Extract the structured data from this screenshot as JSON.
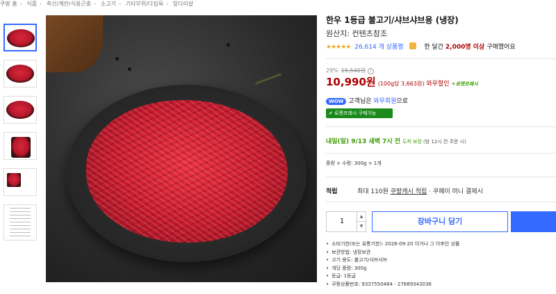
{
  "breadcrumb": [
    "쿠팡 홈",
    "식품",
    "축산/계란/식용곤충",
    "소고기",
    "기타부위/다짐육",
    "앞다리살"
  ],
  "breadcrumb_sep": "›",
  "product": {
    "title": "한우 1등급 불고기/샤브샤브용 (냉장)",
    "origin": "원산지: 컨텐츠참조",
    "stars": "★★★★★",
    "reviews": "26,614 개 상품평",
    "bought_prefix": "한 달간",
    "bought_count": "2,000명 이상",
    "bought_suffix": "구매했어요"
  },
  "price": {
    "discount_rate": "29%",
    "original": "15,540원",
    "info_icon": "i",
    "final": "10,990원",
    "unit_price": "(100g당 3,663원)",
    "wow_discount": "와우할인",
    "rocket_fresh": "✈로켓프레시"
  },
  "wow": {
    "badge": "WOW",
    "text_prefix": "고객님은",
    "member_link": "와우회원",
    "text_suffix": "으로"
  },
  "rocket_button": "✔ 로켓프레시 구매가능",
  "delivery": {
    "date": "내일(일) 9/13 새벽 7시 전",
    "guarantee": "도착 보장",
    "note": "(밤 12시 전 주문 시)"
  },
  "option": "중량 × 수량: 300g × 1개",
  "reward": {
    "label": "적립",
    "prefix": "최대 110원",
    "cash": "쿠팡캐시 적립",
    "suffix": "· 쿠페이 머니 결제시"
  },
  "quantity": {
    "value": "1",
    "up": "▲",
    "down": "▼"
  },
  "cart_button": "장바구니 담기",
  "details": [
    "소비기한(또는 유통기한): 2026-09-20 이거나 그 이후인 상품",
    "보관방법: 냉장보관",
    "고기 용도: 불고기/샤브샤브",
    "개당 중량: 300g",
    "등급: 1등급",
    "쿠팡상품번호: 9337550484 - 27689343036"
  ],
  "colors": {
    "accent": "#346aff",
    "price": "#ae0000",
    "rocket": "#3a9a00"
  }
}
